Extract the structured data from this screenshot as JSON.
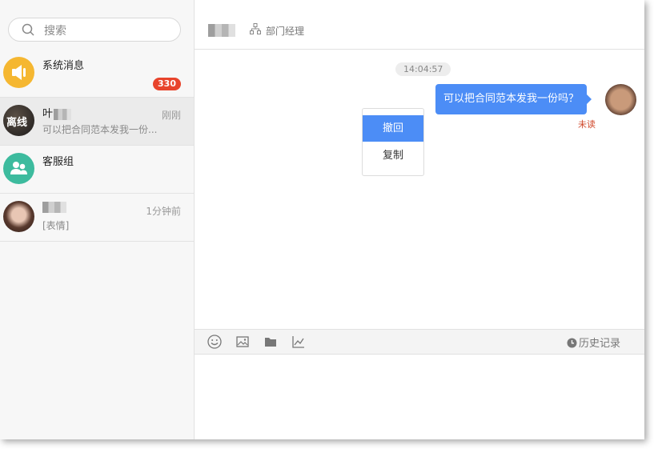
{
  "search": {
    "placeholder": "搜索"
  },
  "conversations": [
    {
      "name": "系统消息",
      "badge": "330"
    },
    {
      "name": "叶",
      "time": "刚刚",
      "preview": "可以把合同范本发我一份...",
      "avatar_overlay": "离线"
    },
    {
      "name": "客服组"
    },
    {
      "name": "",
      "time": "1分钟前",
      "preview": "[表情]"
    }
  ],
  "chat": {
    "title": "",
    "role": "部门经理",
    "timestamp": "14:04:57",
    "message": "可以把合同范本发我一份吗？",
    "status": "未读"
  },
  "context_menu": {
    "items": [
      "撤回",
      "复制"
    ],
    "selected": 0
  },
  "toolbar": {
    "tools": [
      "emoji-icon",
      "image-icon",
      "folder-icon",
      "chart-icon"
    ],
    "history_label": "历史记录"
  },
  "colors": {
    "accent": "#4c8df6",
    "badge": "#e8442c",
    "system_avatar": "#f5b731",
    "group_avatar": "#3dbb9e"
  }
}
